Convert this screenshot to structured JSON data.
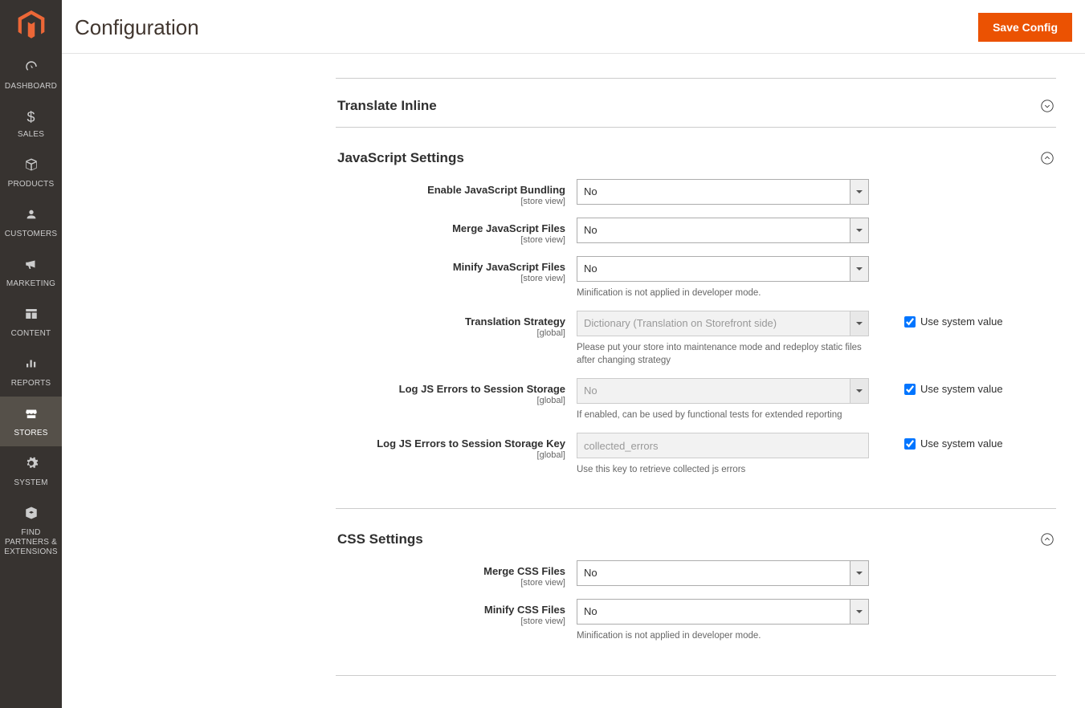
{
  "header": {
    "title": "Configuration",
    "save_button": "Save Config"
  },
  "sidebar": {
    "items": [
      {
        "icon": "dashboard",
        "label": "DASHBOARD"
      },
      {
        "icon": "sales",
        "label": "SALES"
      },
      {
        "icon": "products",
        "label": "PRODUCTS"
      },
      {
        "icon": "customers",
        "label": "CUSTOMERS"
      },
      {
        "icon": "marketing",
        "label": "MARKETING"
      },
      {
        "icon": "content",
        "label": "CONTENT"
      },
      {
        "icon": "reports",
        "label": "REPORTS"
      },
      {
        "icon": "stores",
        "label": "STORES"
      },
      {
        "icon": "system",
        "label": "SYSTEM"
      },
      {
        "icon": "partners",
        "label": "FIND PARTNERS & EXTENSIONS"
      }
    ],
    "active_index": 7
  },
  "sections": {
    "translate": {
      "title": "Translate Inline",
      "expanded": false
    },
    "js": {
      "title": "JavaScript Settings",
      "expanded": true,
      "fields": {
        "bundle": {
          "label": "Enable JavaScript Bundling",
          "scope": "[store view]",
          "value": "No"
        },
        "merge": {
          "label": "Merge JavaScript Files",
          "scope": "[store view]",
          "value": "No"
        },
        "minify": {
          "label": "Minify JavaScript Files",
          "scope": "[store view]",
          "value": "No",
          "note": "Minification is not applied in developer mode."
        },
        "translation": {
          "label": "Translation Strategy",
          "scope": "[global]",
          "value": "Dictionary (Translation on Storefront side)",
          "note": "Please put your store into maintenance mode and redeploy static files after changing strategy",
          "system": true
        },
        "log_errors": {
          "label": "Log JS Errors to Session Storage",
          "scope": "[global]",
          "value": "No",
          "note": "If enabled, can be used by functional tests for extended reporting",
          "system": true
        },
        "log_key": {
          "label": "Log JS Errors to Session Storage Key",
          "scope": "[global]",
          "value": "collected_errors",
          "note": "Use this key to retrieve collected js errors",
          "system": true
        }
      }
    },
    "css": {
      "title": "CSS Settings",
      "expanded": true,
      "fields": {
        "merge": {
          "label": "Merge CSS Files",
          "scope": "[store view]",
          "value": "No"
        },
        "minify": {
          "label": "Minify CSS Files",
          "scope": "[store view]",
          "value": "No",
          "note": "Minification is not applied in developer mode."
        }
      }
    }
  },
  "labels": {
    "use_system": "Use system value"
  }
}
